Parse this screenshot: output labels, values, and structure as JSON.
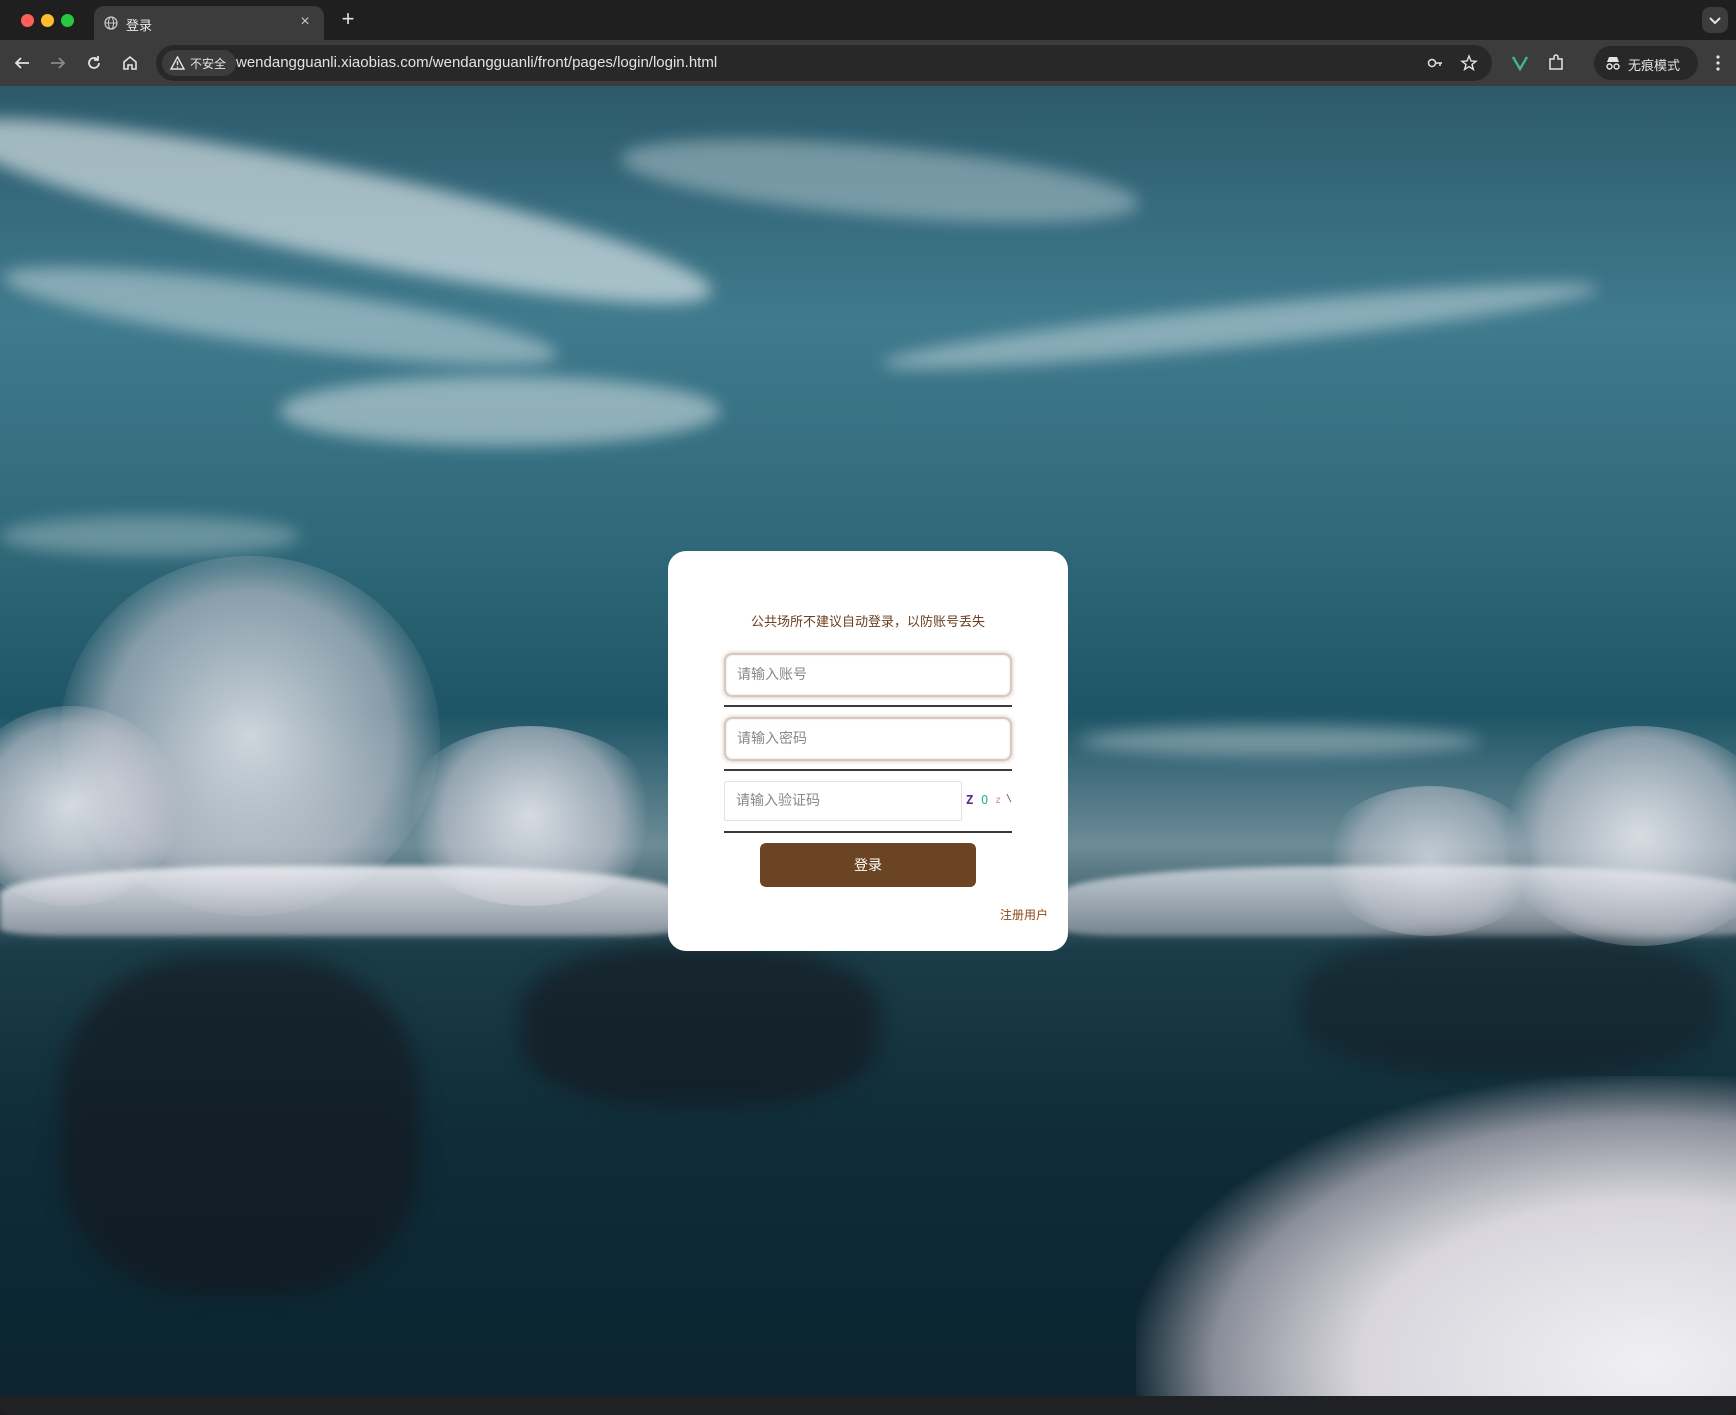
{
  "browser": {
    "tab_title": "登录",
    "url": "wendangguanli.xiaobias.com/wendangguanli/front/pages/login/login.html",
    "security_label": "不安全",
    "incognito_label": "无痕模式"
  },
  "login": {
    "notice": "公共场所不建议自动登录，以防账号丢失",
    "account_placeholder": "请输入账号",
    "password_placeholder": "请输入密码",
    "captcha_placeholder": "请输入验证码",
    "captcha_chars": [
      "Z",
      "O",
      "z",
      "\\"
    ],
    "captcha_colors": [
      "#5a2a8a",
      "#2bb3a0",
      "#d98a8a",
      "#7a4a2a"
    ],
    "login_button": "登录",
    "register_link": "注册用户",
    "accent_color": "#6b4423"
  }
}
